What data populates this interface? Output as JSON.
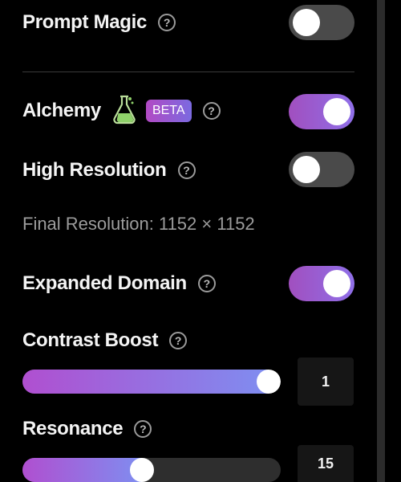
{
  "prompt_magic": {
    "label": "Prompt Magic",
    "help": "?",
    "enabled": false
  },
  "alchemy": {
    "label": "Alchemy",
    "badge": "BETA",
    "help": "?",
    "enabled": true,
    "icon": "flask-icon"
  },
  "high_resolution": {
    "label": "High Resolution",
    "help": "?",
    "enabled": false
  },
  "final_resolution": "Final Resolution: 1152 × 1152",
  "expanded_domain": {
    "label": "Expanded Domain",
    "help": "?",
    "enabled": true
  },
  "contrast_boost": {
    "label": "Contrast Boost",
    "help": "?",
    "value": "1",
    "level": 1.0
  },
  "resonance": {
    "label": "Resonance",
    "help": "?",
    "value": "15",
    "level": 0.46
  },
  "colors": {
    "accent_start": "#a14fbf",
    "accent_end": "#8f6fe8",
    "toggle_off": "#4a4a4a",
    "background": "#000000"
  }
}
